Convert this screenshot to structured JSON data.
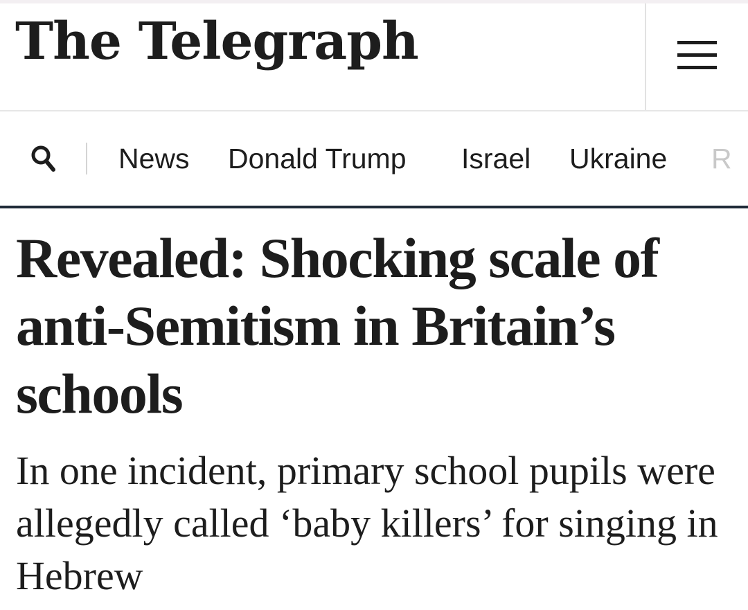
{
  "masthead": {
    "logo_text": "The Telegraph",
    "menu_icon": "hamburger-menu-icon"
  },
  "nav": {
    "search_icon": "search-icon",
    "items": [
      {
        "label": "News"
      },
      {
        "label": "Donald Trump"
      },
      {
        "label": "Israel"
      },
      {
        "label": "Ukraine"
      },
      {
        "label": "R"
      }
    ]
  },
  "article": {
    "headline": "Revealed: Shocking scale of anti-Semitism in Britain’s schools",
    "standfirst": "In one incident, primary school pupils were allegedly called ‘baby killers’ for singing in Hebrew"
  },
  "colors": {
    "text": "#1d1d1d",
    "nav_rule": "#1f2a38",
    "divider": "#e2e2e2"
  }
}
